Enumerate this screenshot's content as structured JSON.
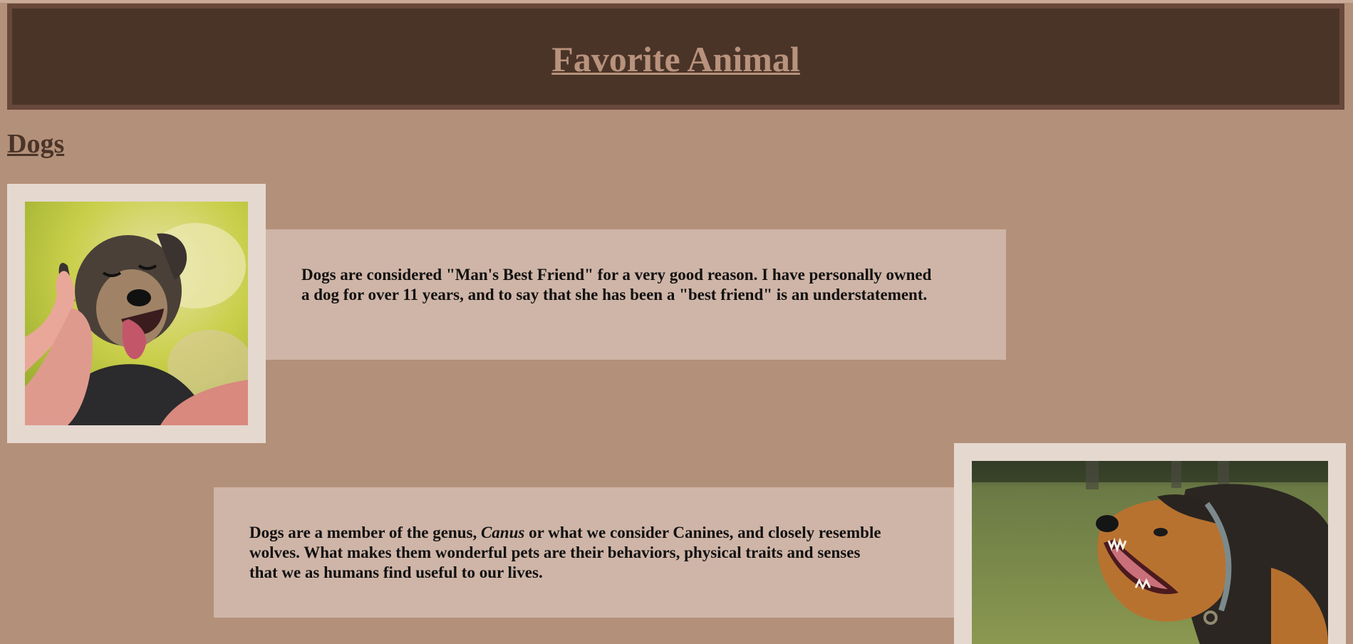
{
  "header": {
    "title": "Favorite Animal"
  },
  "section": {
    "heading": "Dogs"
  },
  "cards": [
    {
      "text": "Dogs are considered \"Man's Best Friend\" for a very good reason. I have personally owned a dog for over 11 years, and to say that she has been a \"best friend\" is an understatement."
    },
    {
      "text_before": "Dogs are a member of the genus, ",
      "genus": "Canus",
      "text_after": " or what we consider Canines, and closely resemble wolves. What makes them wonderful pets are their behaviors, physical traits and senses that we as humans find useful to our lives."
    }
  ],
  "colors": {
    "page_background": "#b39079",
    "header_background": "#4a3428",
    "header_border": "#68483a",
    "header_title": "#b8927c",
    "section_heading": "#4a3428",
    "card_background": "#cfb5a7",
    "photo_frame": "#e5d8cf"
  }
}
